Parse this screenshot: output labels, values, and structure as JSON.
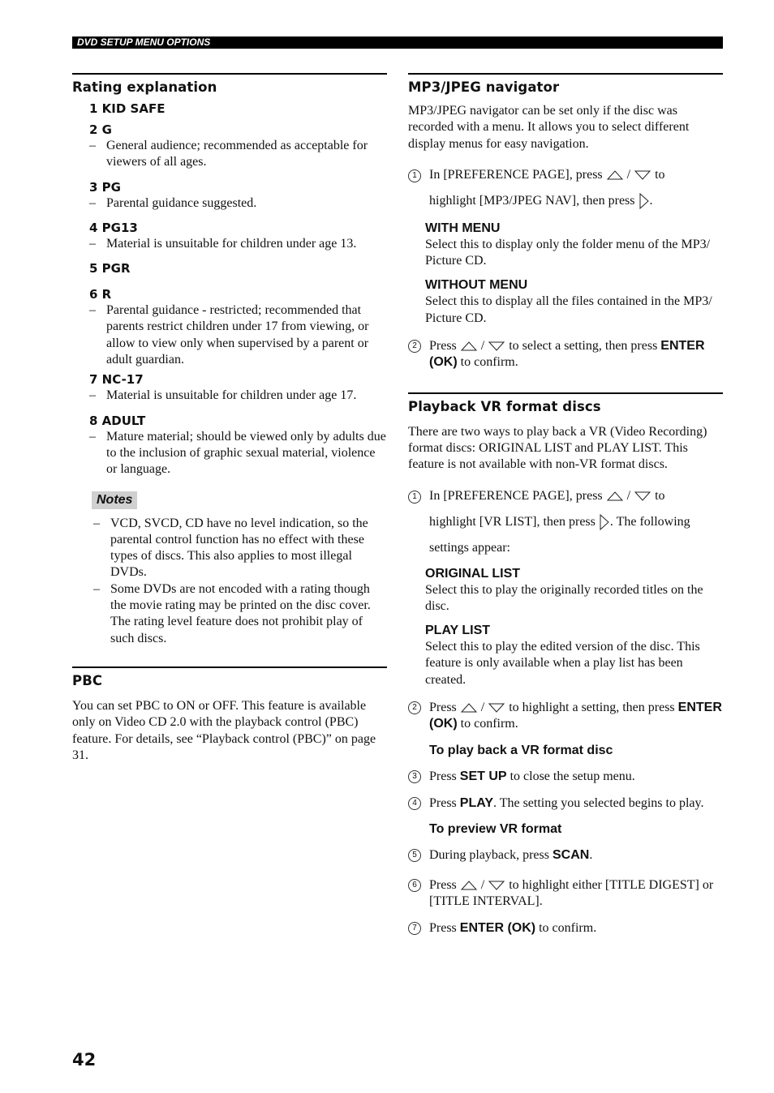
{
  "header": {
    "section_title": "DVD SETUP MENU OPTIONS"
  },
  "page_number": "42",
  "left": {
    "rating": {
      "title": "Rating explanation",
      "levels": [
        {
          "label": "1 KID SAFE",
          "desc": []
        },
        {
          "label": "2 G",
          "desc": [
            "General audience; recommended as acceptable for viewers of all ages."
          ]
        },
        {
          "label": "3 PG",
          "desc": [
            "Parental guidance suggested."
          ]
        },
        {
          "label": "4 PG13",
          "desc": [
            "Material is unsuitable for children under age 13."
          ]
        },
        {
          "label": "5 PGR",
          "desc": []
        },
        {
          "label": "6 R",
          "desc": [
            "Parental guidance - restricted; recommended that parents restrict children under 17 from viewing, or allow to view only when supervised by a parent or adult guardian."
          ]
        },
        {
          "label": "7 NC-17",
          "desc": [
            "Material is unsuitable for children under age 17."
          ]
        },
        {
          "label": "8 ADULT",
          "desc": [
            "Mature material; should be viewed only by adults due to the inclusion of graphic sexual material, violence or language."
          ]
        }
      ],
      "notes_label": "Notes",
      "notes": [
        "VCD, SVCD, CD have no level indication, so the parental control function has no effect with these types of discs. This also applies to most illegal DVDs.",
        "Some DVDs are not encoded with a rating though the movie rating may be printed on the disc cover. The rating level feature does not prohibit play of such discs."
      ]
    },
    "pbc": {
      "title": "PBC",
      "body": "You can set PBC to ON or OFF. This feature is available only on Video CD 2.0 with the playback control (PBC) feature. For details, see “Playback control (PBC)” on page 31."
    }
  },
  "right": {
    "mp3": {
      "title": "MP3/JPEG navigator",
      "intro": "MP3/JPEG navigator can be set only if the disc was recorded with a menu. It allows you to select different display menus for easy navigation.",
      "step1": {
        "num": "1",
        "a": "In [PREFERENCE PAGE], press",
        "sep": "/",
        "b": "to",
        "c": "highlight [MP3/JPEG NAV], then press",
        "d": "."
      },
      "options": [
        {
          "label": "WITH MENU",
          "desc": "Select this to display only the folder menu of the MP3/ Picture CD."
        },
        {
          "label": "WITHOUT MENU",
          "desc": "Select this to display all the files contained in the MP3/ Picture CD."
        }
      ],
      "step2": {
        "num": "2",
        "a": "Press",
        "sep": "/",
        "b": "to select a setting, then press",
        "key": "ENTER (OK)",
        "c": "to confirm."
      }
    },
    "vr": {
      "title": "Playback VR format discs",
      "intro": "There are two ways to play back a VR (Video Recording) format discs: ORIGINAL LIST and PLAY LIST. This feature is not available with non-VR format discs.",
      "step1": {
        "num": "1",
        "a": "In [PREFERENCE PAGE], press",
        "sep": "/",
        "b": "to",
        "c": "highlight [VR LIST], then press",
        "d": ". The following settings appear:"
      },
      "options": [
        {
          "label": "ORIGINAL LIST",
          "desc": "Select this to play the originally recorded titles on the disc."
        },
        {
          "label": "PLAY LIST",
          "desc": "Select this to play the edited version of the disc. This feature is only available when a play list has been created."
        }
      ],
      "step2": {
        "num": "2",
        "a": "Press",
        "sep": "/",
        "b": "to highlight a setting, then press",
        "key": "ENTER (OK)",
        "c": "to confirm."
      },
      "sub1": "To play back a VR format disc",
      "step3": {
        "num": "3",
        "a": "Press",
        "key": "SET UP",
        "b": "to close the setup menu."
      },
      "step4": {
        "num": "4",
        "a": "Press",
        "key": "PLAY",
        "b": ". The setting you selected begins to play."
      },
      "sub2": "To preview VR format",
      "step5": {
        "num": "5",
        "a": "During playback, press",
        "key": "SCAN",
        "b": "."
      },
      "step6": {
        "num": "6",
        "a": "Press",
        "sep": "/",
        "b": "to highlight either [TITLE DIGEST] or [TITLE INTERVAL]."
      },
      "step7": {
        "num": "7",
        "a": "Press",
        "key": "ENTER (OK)",
        "b": "to confirm."
      }
    }
  },
  "icons": {
    "up": "up-triangle-icon",
    "down": "down-triangle-icon",
    "right": "right-triangle-icon"
  }
}
